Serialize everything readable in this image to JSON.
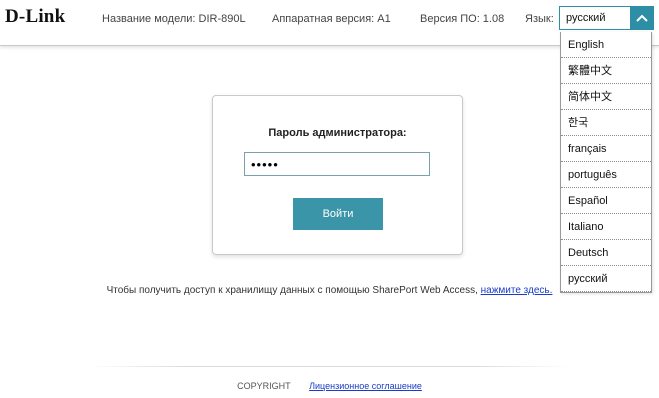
{
  "header": {
    "logo": "D-Link",
    "model": "Название модели: DIR-890L",
    "hardware": "Аппаратная версия: A1",
    "firmware": "Версия ПО: 1.08",
    "language_label": "Язык:"
  },
  "language_select": {
    "selected": "русский",
    "options": [
      "English",
      "繁體中文",
      "简体中文",
      "한국",
      "français",
      "português",
      "Español",
      "Italiano",
      "Deutsch",
      "русский"
    ]
  },
  "login": {
    "label": "Пароль администратора:",
    "password_value": "•••••",
    "button_label": "Войти"
  },
  "sharepoint": {
    "text": "Чтобы получить доступ к хранилищу данных с помощью SharePort Web Access, ",
    "link": "нажмите здесь."
  },
  "footer": {
    "copyright": "COPYRIGHT",
    "license_link": "Лицензионное соглашение"
  },
  "colors": {
    "accent": "#3a95a8",
    "link": "#1a3cc8"
  }
}
